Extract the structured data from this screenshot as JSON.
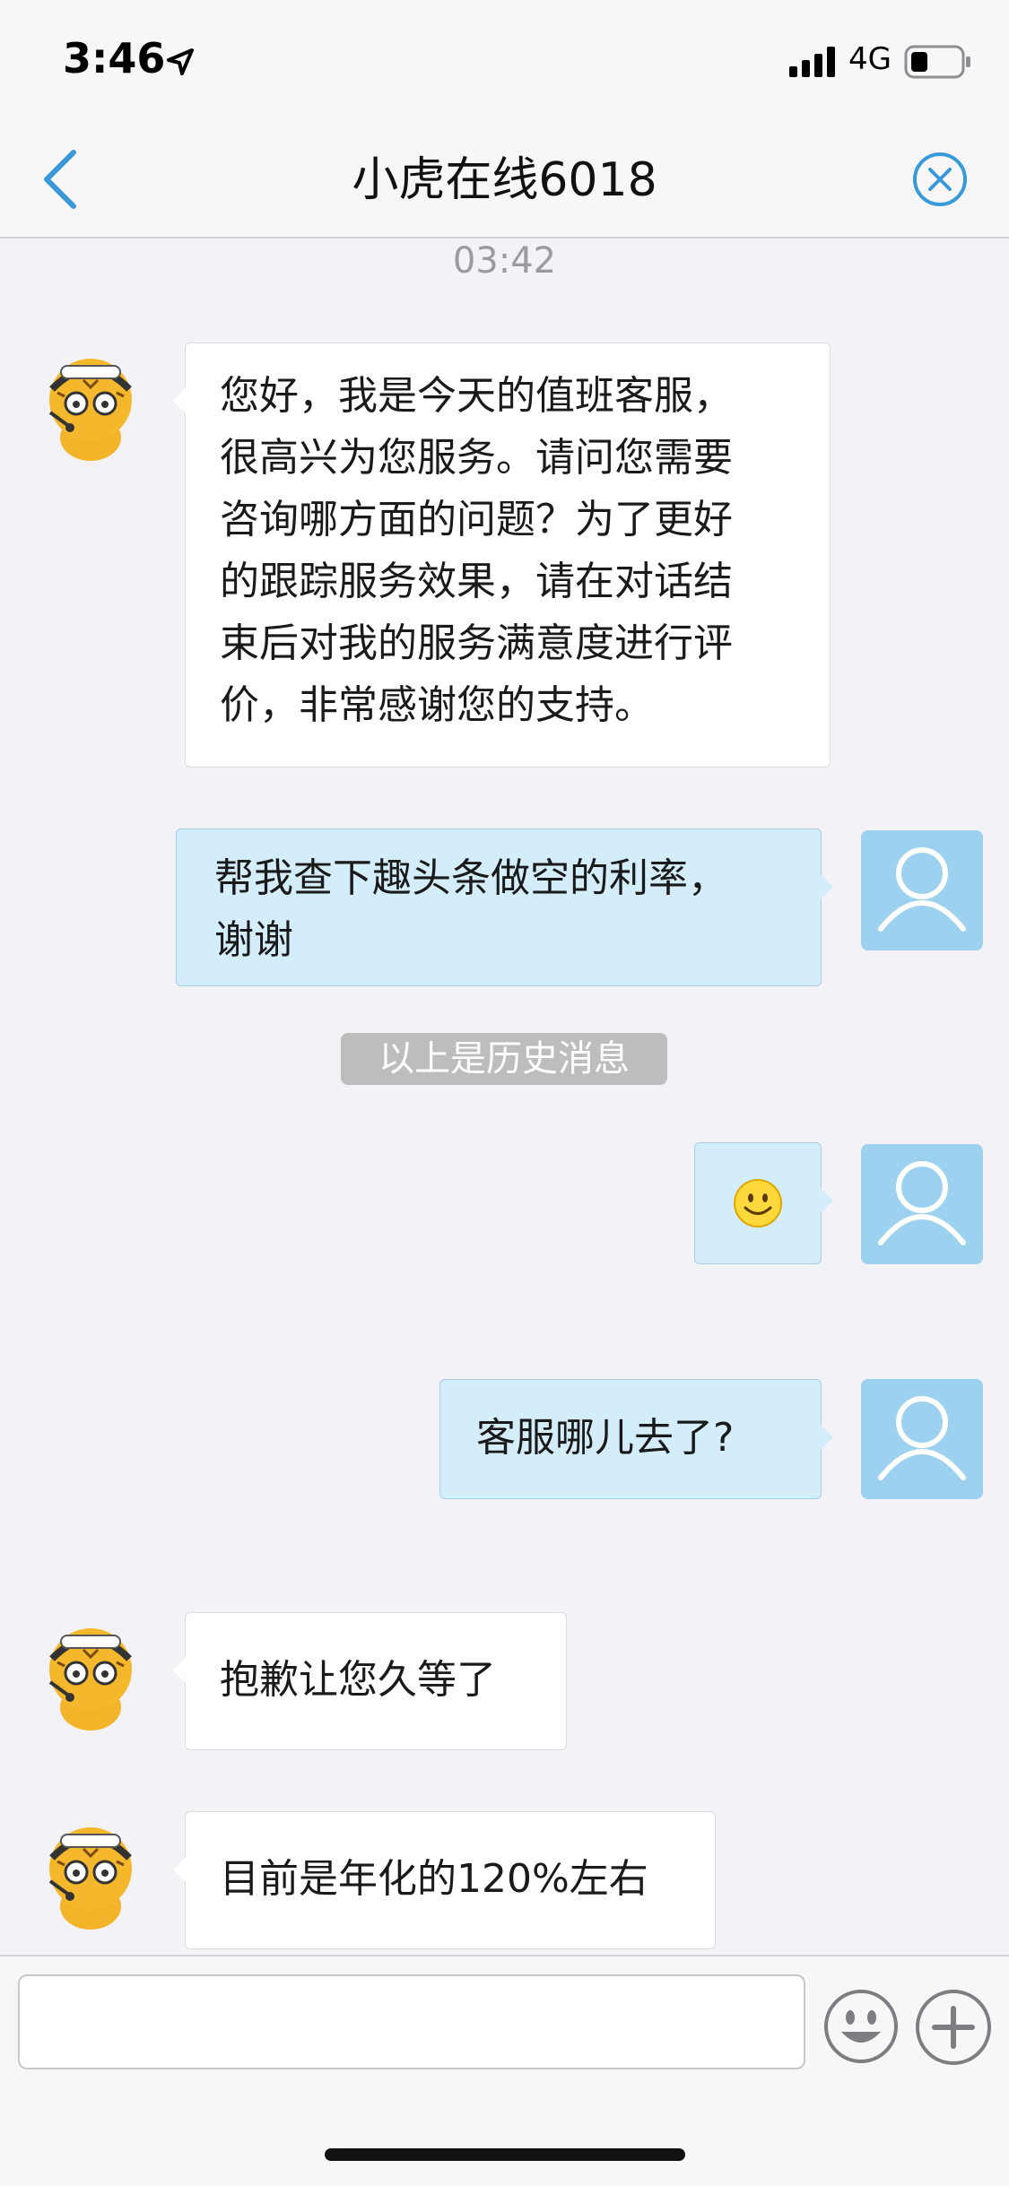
{
  "status_bar": {
    "time": "3:46",
    "network": "4G"
  },
  "nav": {
    "title": "小虎在线6018"
  },
  "chat": {
    "timestamp": "03:42",
    "messages": [
      {
        "sender": "agent",
        "text": "您好，我是今天的值班客服，\n很高兴为您服务。请问您需要\n咨询哪方面的问题？为了更好\n的跟踪服务效果，请在对话结\n束后对我的服务满意度进行评\n价，非常感谢您的支持。"
      },
      {
        "sender": "user",
        "text": "帮我查下趣头条做空的利率，\n谢谢"
      },
      {
        "sender": "user",
        "text": "🙂"
      },
      {
        "sender": "user",
        "text": "客服哪儿去了?"
      },
      {
        "sender": "agent",
        "text": "抱歉让您久等了"
      },
      {
        "sender": "agent",
        "text": "目前是年化的120%左右"
      }
    ],
    "history_divider": "以上是历史消息"
  },
  "input": {
    "placeholder": ""
  },
  "colors": {
    "accent": "#3a9ad9",
    "user_bubble": "#d3edfb",
    "agent_bubble": "#ffffff",
    "avatar_user_bg": "#9cd2ef"
  },
  "icons": [
    "back-chevron-icon",
    "close-circle-icon",
    "emoji-icon",
    "plus-icon",
    "location-arrow-icon",
    "signal-icon",
    "battery-icon"
  ]
}
